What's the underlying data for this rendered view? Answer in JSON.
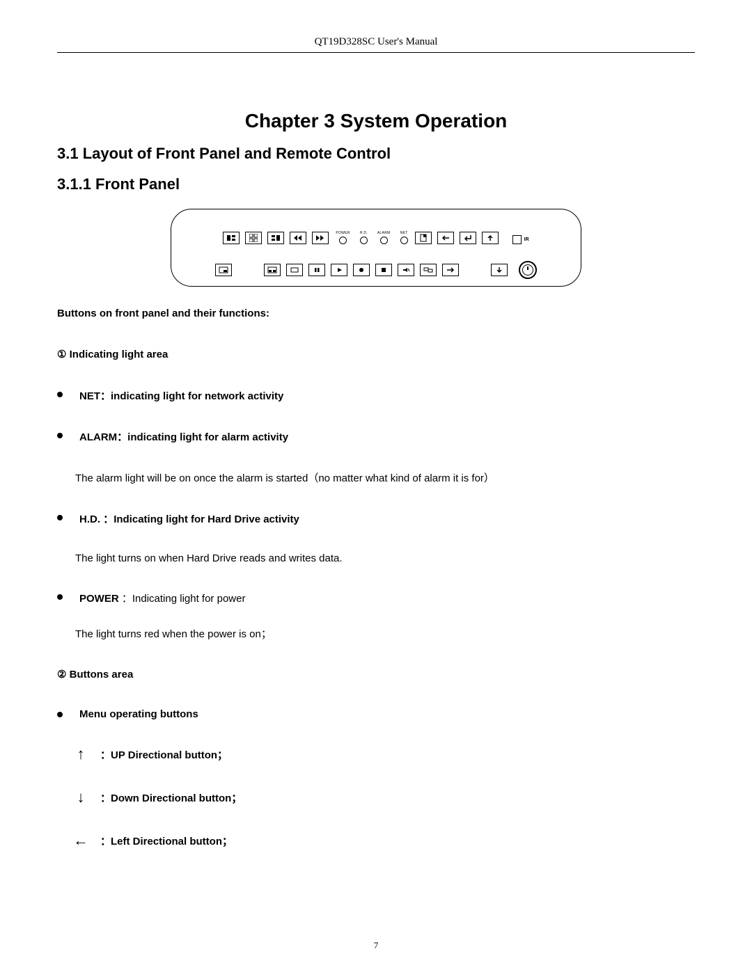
{
  "header": "QT19D328SC User's Manual",
  "chapter": "Chapter 3 System Operation",
  "section": "3.1 Layout of Front Panel and Remote Control",
  "subsection": "3.1.1 Front Panel",
  "panel": {
    "leds": [
      "POWER",
      "H.D.",
      "ALARM",
      "NET"
    ],
    "ir": "IR"
  },
  "body": {
    "intro": "Buttons on front panel and their functions:",
    "area1": "① Indicating light area",
    "net": {
      "label": "NET",
      "sep": "：",
      "desc": "indicating light for network activity"
    },
    "alarm": {
      "label": "ALARM",
      "sep": "：",
      "desc": "indicating light for alarm activity"
    },
    "alarm_note": "The alarm light will be on once the alarm is started（no matter what kind of alarm it is for）",
    "hd": {
      "label": "H.D.  ",
      "sep": "：",
      "desc": "Indicating light for Hard Drive activity"
    },
    "hd_note": "The light turns on when Hard Drive reads and writes data.",
    "power": {
      "label": "POWER  ",
      "sep": "：",
      "desc": "Indicating light for power"
    },
    "power_note": "The light turns red when the power is on；",
    "area2": "② Buttons area",
    "menu_ops": "Menu operating buttons",
    "dir_up": "：UP Directional button；",
    "dir_down": "：Down Directional button；",
    "dir_left": "：Left Directional button；"
  },
  "page_number": "7"
}
